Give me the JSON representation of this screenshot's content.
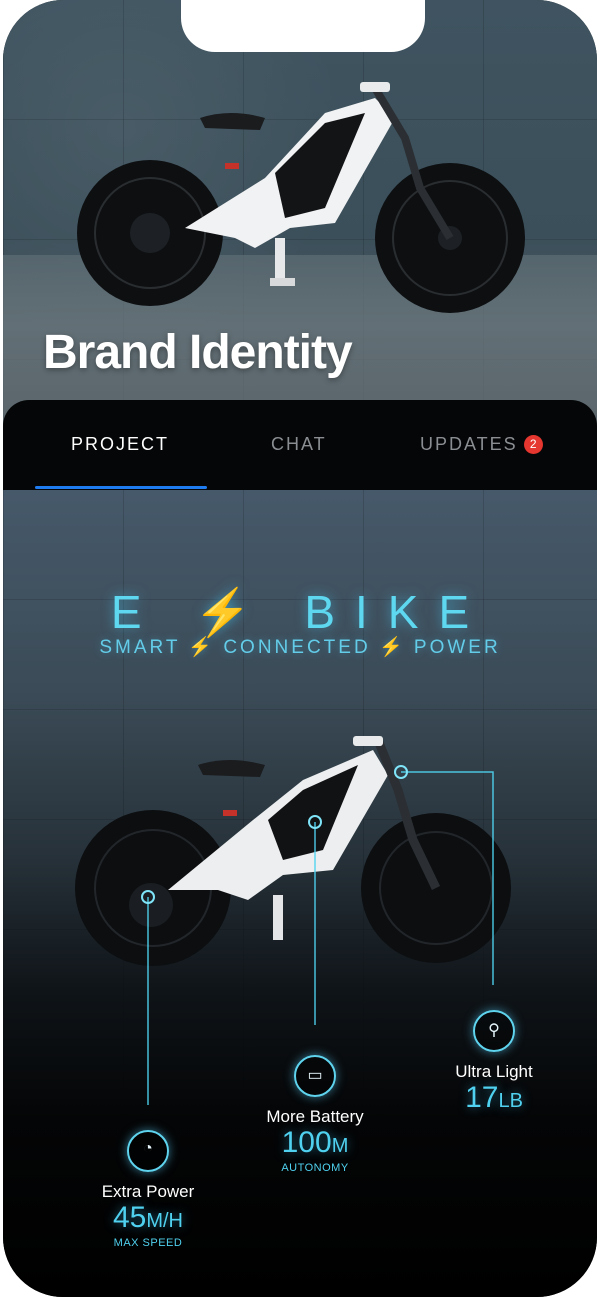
{
  "hero": {
    "title": "Brand Identity"
  },
  "tabs": [
    {
      "label": "PROJECT",
      "active": true
    },
    {
      "label": "CHAT",
      "active": false
    },
    {
      "label": "UPDATES",
      "active": false,
      "badge": "2"
    }
  ],
  "ebike": {
    "title": "E ⚡ BIKE",
    "subtitle": "SMART ⚡ CONNECTED ⚡ POWER"
  },
  "features": [
    {
      "icon": "speedometer-icon",
      "label": "Extra Power",
      "value": "45",
      "unit": "M/H",
      "caption": "MAX SPEED"
    },
    {
      "icon": "battery-icon",
      "label": "More Battery",
      "value": "100",
      "unit": "M",
      "caption": "AUTONOMY"
    },
    {
      "icon": "feather-icon",
      "label": "Ultra Light",
      "value": "17",
      "unit": "LB",
      "caption": ""
    }
  ],
  "colors": {
    "accent": "#4fd1ef",
    "tab_indicator": "#1f7cf0",
    "badge": "#e5362f"
  }
}
